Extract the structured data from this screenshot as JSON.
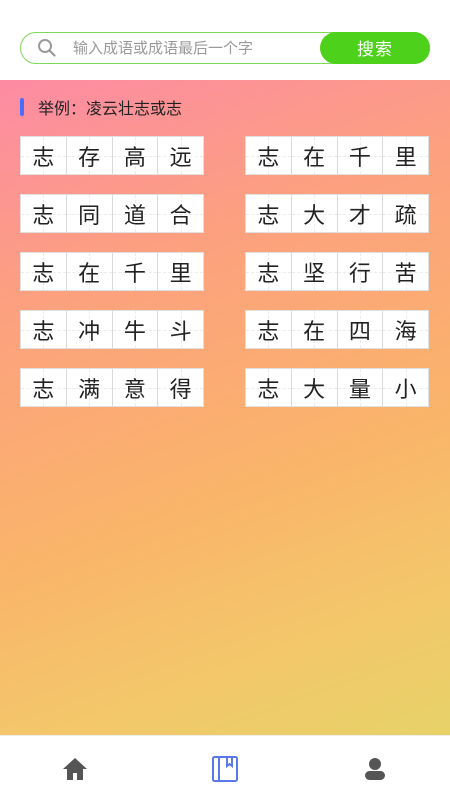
{
  "search": {
    "placeholder": "输入成语或成语最后一个字",
    "button_label": "搜索",
    "accent_color": "#4ed11a"
  },
  "example": {
    "text": "举例：凌云壮志或志"
  },
  "idioms": [
    {
      "chars": [
        "志",
        "存",
        "高",
        "远"
      ]
    },
    {
      "chars": [
        "志",
        "在",
        "千",
        "里"
      ]
    },
    {
      "chars": [
        "志",
        "同",
        "道",
        "合"
      ]
    },
    {
      "chars": [
        "志",
        "大",
        "才",
        "疏"
      ]
    },
    {
      "chars": [
        "志",
        "在",
        "千",
        "里"
      ]
    },
    {
      "chars": [
        "志",
        "坚",
        "行",
        "苦"
      ]
    },
    {
      "chars": [
        "志",
        "冲",
        "牛",
        "斗"
      ]
    },
    {
      "chars": [
        "志",
        "在",
        "四",
        "海"
      ]
    },
    {
      "chars": [
        "志",
        "满",
        "意",
        "得"
      ]
    },
    {
      "chars": [
        "志",
        "大",
        "量",
        "小"
      ]
    }
  ],
  "bottom_nav": [
    {
      "icon": "home-icon"
    },
    {
      "icon": "book-icon"
    },
    {
      "icon": "user-icon"
    }
  ]
}
